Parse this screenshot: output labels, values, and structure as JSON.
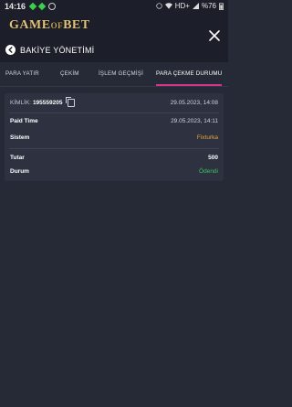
{
  "status_bar": {
    "time": "14:16",
    "network": "HD+",
    "battery": "%76"
  },
  "header": {
    "logo_main": "GAME",
    "logo_sub": "OF",
    "logo_end": "BET",
    "title": "BAKİYE YÖNETİMİ"
  },
  "tabs": [
    {
      "label": "PARA YATIR"
    },
    {
      "label": "ÇEKİM"
    },
    {
      "label": "İŞLEM GEÇMİŞİ"
    },
    {
      "label": "PARA ÇEKME DURUMU"
    }
  ],
  "record": {
    "id_label": "KİMLİK:",
    "id_value": "195559205",
    "created_at": "29.05.2023, 14:08",
    "paid_time_label": "Paid Time",
    "paid_time_value": "29.05.2023, 14:11",
    "system_label": "Sistem",
    "system_value": "Fixturka",
    "amount_label": "Tutar",
    "amount_value": "500",
    "status_label": "Durum",
    "status_value": "Ödendi"
  },
  "colors": {
    "accent": "#d8338c",
    "system": "#e6a33a",
    "paid": "#3cc35b"
  }
}
